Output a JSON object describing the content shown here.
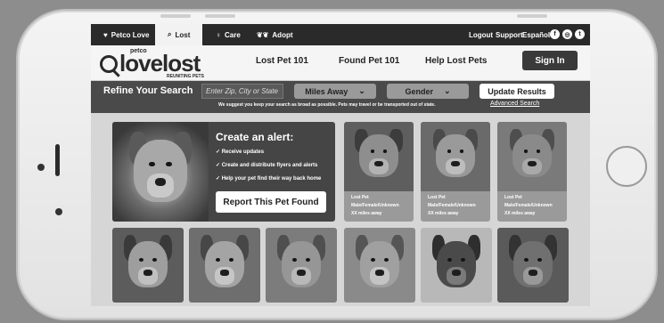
{
  "topnav": {
    "items": [
      "Petco Love",
      "Lost",
      "Care",
      "Adopt"
    ],
    "right": [
      "Logout",
      "Support",
      "Español"
    ]
  },
  "header": {
    "brand_small": "petco",
    "logo": "lovelost",
    "tagline": "REUNITING PETS",
    "links": [
      "Lost Pet 101",
      "Found Pet 101",
      "Help Lost Pets"
    ],
    "signin": "Sign In"
  },
  "search": {
    "title": "Refine Your Search",
    "placeholder": "Enter Zip, City or State",
    "distance": "Miles Away",
    "gender": "Gender",
    "update": "Update Results",
    "note": "We suggest you keep your search as broad as possible. Pets may travel or be transported out of state.",
    "advanced": "Advanced Search"
  },
  "alert": {
    "title": "Create an alert:",
    "items": [
      "✓ Receive updates",
      "✓ Create  and distribute flyers and alerts",
      "✓ Help your pet find their way back home"
    ],
    "button": "Report This Pet Found"
  },
  "pets": [
    {
      "status": "Lost Pet",
      "sex": "Male/Female/Unknown",
      "distance": "XX miles away"
    },
    {
      "status": "Lost Pet",
      "sex": "Male/Female/Unknown",
      "distance": "XX miles away"
    },
    {
      "status": "Lost Pet",
      "sex": "Male/Female/Unknown",
      "distance": "XX miles away"
    }
  ],
  "icons": {
    "petco_love": "heart-icon",
    "lost": "magnifier-icon",
    "care": "stethoscope-icon",
    "adopt": "pets-group-icon",
    "social": [
      "facebook-icon",
      "instagram-icon",
      "twitter-icon"
    ]
  },
  "colors": {
    "topnav_bg": "#2a2a2a",
    "searchbar_bg": "#4a4a4a",
    "alert_bg": "#454545",
    "signin_bg": "#3a3a3a"
  }
}
